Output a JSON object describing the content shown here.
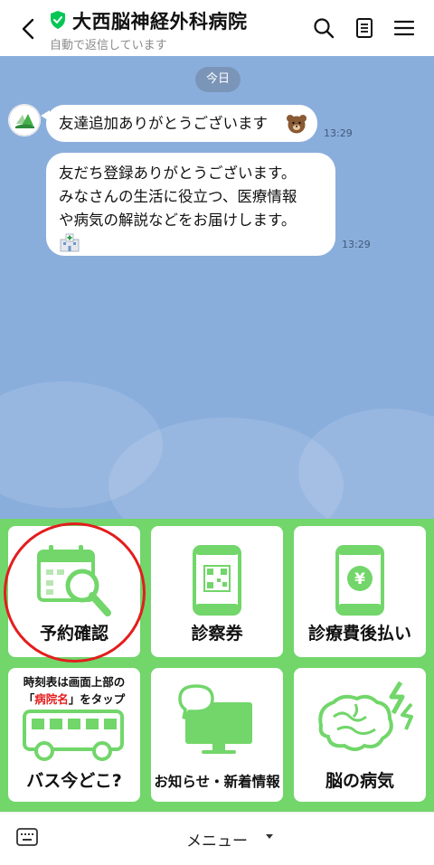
{
  "header": {
    "title": "大西脳神経外科病院",
    "subtitle": "自動で返信しています"
  },
  "chat": {
    "date_label": "今日",
    "messages": [
      {
        "text": "友達追加ありがとうございます",
        "emoji": "bear-face",
        "time": "13:29"
      },
      {
        "lines": [
          "友だち登録ありがとうございます。",
          "みなさんの生活に役立つ、医療情報",
          "や病気の解説などをお届けします。"
        ],
        "emoji": "hospital",
        "time": "13:29"
      }
    ]
  },
  "rich_menu": {
    "tiles": [
      {
        "label": "予約確認",
        "icon": "calendar-search-icon"
      },
      {
        "label": "診察券",
        "icon": "phone-qr-icon"
      },
      {
        "label": "診療費後払い",
        "icon": "phone-yen-icon"
      },
      {
        "label": "バス今どこ?",
        "icon": "bus-icon",
        "note_line1": "時刻表は画面上部の",
        "note_bracket_open": "「",
        "note_highlight": "病院名",
        "note_bracket_close": "」をタップ"
      },
      {
        "label": "お知らせ・新着情報",
        "icon": "monitor-chat-icon"
      },
      {
        "label": "脳の病気",
        "icon": "brain-icon"
      }
    ],
    "accent": "#72d66a",
    "highlight_color": "#e31d1d"
  },
  "footer": {
    "menu_label": "メニュー"
  }
}
